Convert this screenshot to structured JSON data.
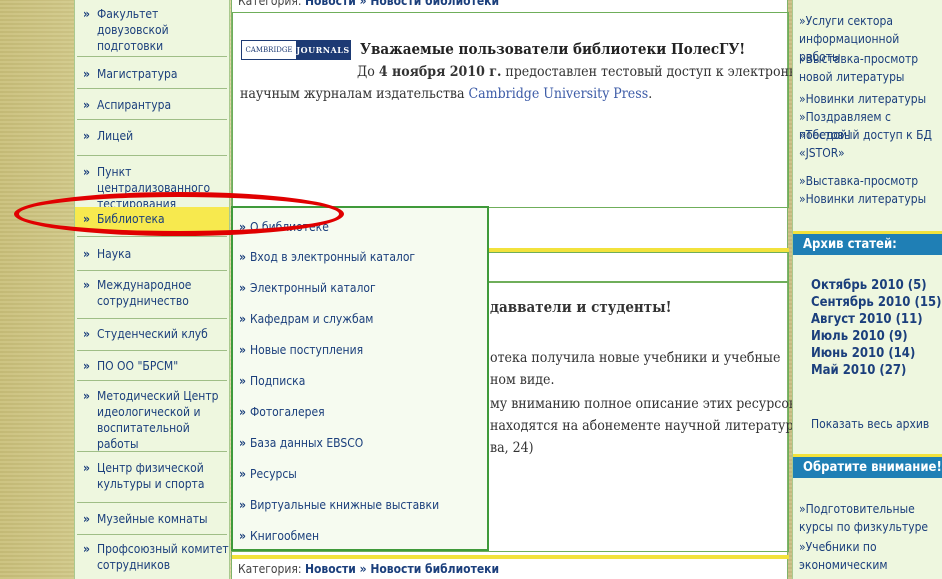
{
  "left_nav": {
    "items": [
      {
        "label": "Факультет довузовской подготовки"
      },
      {
        "label": "Магистратура"
      },
      {
        "label": "Аспирантура"
      },
      {
        "label": "Лицей"
      },
      {
        "label": "Пункт централизованного тестирования"
      },
      {
        "label": "Библиотека"
      },
      {
        "label": "Наука"
      },
      {
        "label": "Международное сотрудничество"
      },
      {
        "label": "Студенческий клуб"
      },
      {
        "label": "ПО ОО \"БРСМ\""
      },
      {
        "label": "Методический Центр идеологической и воспитательной работы"
      },
      {
        "label": "Центр физической культуры и спорта"
      },
      {
        "label": "Музейные комнаты"
      },
      {
        "label": "Профсоюзный комитет сотрудников"
      }
    ],
    "bullet": "»"
  },
  "news1": {
    "category_label": "Категория:",
    "category_link": "Новости » Новости библиотеки",
    "logo_left": "CAMBRIDGE",
    "logo_right": "JOURNALS",
    "title": "Уважаемые пользователи библиотеки ПолесГУ!",
    "line1_pre": "До ",
    "line1_bold": "4 ноября 2010 г.",
    "line1_post": " предоставлен тестовый доступ к электронным",
    "line2_pre": "научным журналам издательства ",
    "line2_link": "Cambridge University Press",
    "line2_post": "."
  },
  "news2": {
    "title_fragment": "давватели и студенты!",
    "line1": "отека  получила  новые  учебники  и  учебные",
    "line2": "ном виде.",
    "line3": "му вниманию полное описание этих ресурсов.",
    "line4": "находятся  на  абонементе  научной  литературы",
    "line5": "ва, 24)"
  },
  "news3": {
    "category_label": "Категория:",
    "category_link": "Новости » Новости библиотеки"
  },
  "dropdown": {
    "items": [
      {
        "label": "О библиотеке"
      },
      {
        "label": "Вход в электронный каталог"
      },
      {
        "label": "Электронный каталог"
      },
      {
        "label": "Кафедрам и службам"
      },
      {
        "label": "Новые поступления"
      },
      {
        "label": "Подписка"
      },
      {
        "label": "Фотогалерея"
      },
      {
        "label": "База данных EBSCO"
      },
      {
        "label": "Ресурсы"
      },
      {
        "label": "Виртуальные книжные выставки"
      },
      {
        "label": "Книгообмен"
      }
    ]
  },
  "right_sidebar": {
    "links": [
      {
        "label": "»Услуги сектора информационной работы"
      },
      {
        "label": "»Выставка-просмотр новой литературы"
      },
      {
        "label": "»Новинки литературы"
      },
      {
        "label": "»Поздравляем с победой!"
      },
      {
        "label": "»Тестовый доступ к БД «JSTOR»"
      },
      {
        "label": "»Выставка-просмотр"
      },
      {
        "label": "»Новинки литературы"
      }
    ],
    "archive_title": "Архив статей:",
    "archive": [
      {
        "label": "Октябрь 2010 (5)"
      },
      {
        "label": "Сентябрь 2010 (15)"
      },
      {
        "label": "Август 2010 (11)"
      },
      {
        "label": "Июль 2010 (9)"
      },
      {
        "label": "Июнь 2010 (14)"
      },
      {
        "label": "Май 2010 (27)"
      }
    ],
    "show_all": "Показать весь архив",
    "attention_title": "Обратите внимание!",
    "attention_links": [
      {
        "label": "»Подготовительные курсы по физкультуре"
      },
      {
        "label": "»Учебники по экономическим"
      }
    ]
  },
  "colors": {
    "link_blue": "#1b3f7c",
    "highlight_yellow": "#f7e94e",
    "header_blue": "#1f7fb5",
    "annotation_red": "#e00000"
  }
}
